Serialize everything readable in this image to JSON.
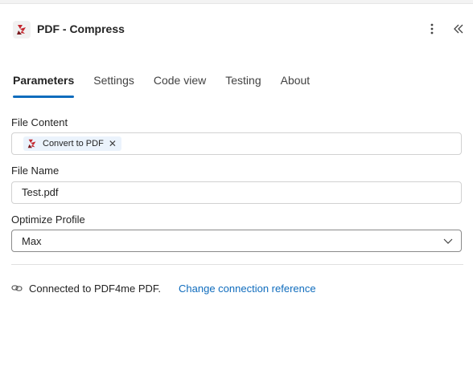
{
  "header": {
    "title": "PDF - Compress",
    "app_icon": "pdf4me-icon",
    "more_icon": "more-vertical-icon",
    "collapse_icon": "double-chevron-left-icon"
  },
  "tabs": [
    {
      "label": "Parameters",
      "active": true
    },
    {
      "label": "Settings",
      "active": false
    },
    {
      "label": "Code view",
      "active": false
    },
    {
      "label": "Testing",
      "active": false
    },
    {
      "label": "About",
      "active": false
    }
  ],
  "fields": {
    "file_content": {
      "label": "File Content",
      "token_label": "Convert to PDF"
    },
    "file_name": {
      "label": "File Name",
      "value": "Test.pdf"
    },
    "optimize_profile": {
      "label": "Optimize Profile",
      "value": "Max"
    }
  },
  "connection": {
    "text": "Connected to PDF4me PDF.",
    "link": "Change connection reference"
  },
  "colors": {
    "accent": "#0f6cbd",
    "brand_red": "#c4262e",
    "chip_bg": "#ebf3fc"
  }
}
